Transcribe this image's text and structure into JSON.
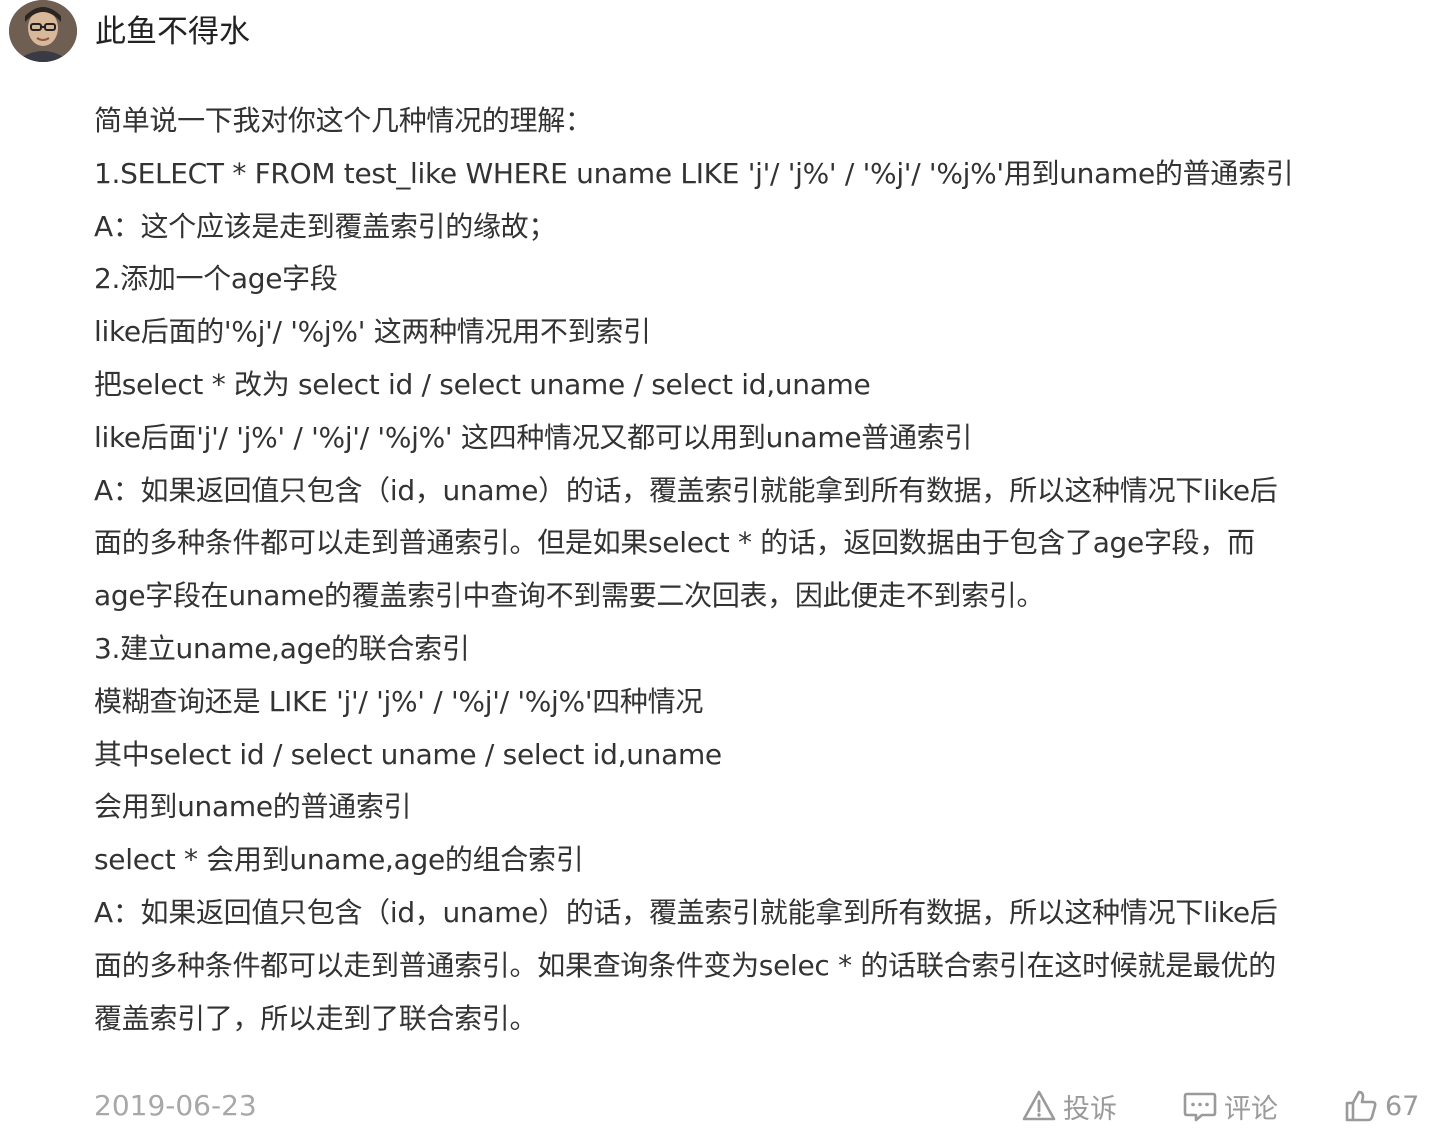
{
  "author": {
    "name": "此鱼不得水"
  },
  "comment": {
    "lines": [
      "简单说一下我对你这个几种情况的理解：",
      "1.SELECT * FROM test_like WHERE uname LIKE 'j'/ 'j%' / '%j'/ '%j%'用到uname的普通索引",
      "A：这个应该是走到覆盖索引的缘故；",
      "2.添加一个age字段",
      "like后面的'%j'/ '%j%' 这两种情况用不到索引",
      "把select * 改为 select id / select uname / select id,uname",
      "like后面'j'/ 'j%' / '%j'/ '%j%' 这四种情况又都可以用到uname普通索引",
      "A：如果返回值只包含（id，uname）的话，覆盖索引就能拿到所有数据，所以这种情况下like后",
      "面的多种条件都可以走到普通索引。但是如果select * 的话，返回数据由于包含了age字段，而",
      "age字段在uname的覆盖索引中查询不到需要二次回表，因此便走不到索引。",
      "3.建立uname,age的联合索引",
      "模糊查询还是 LIKE 'j'/ 'j%' / '%j'/ '%j%'四种情况",
      "其中select id / select uname / select id,uname",
      "会用到uname的普通索引",
      "select * 会用到uname,age的组合索引",
      "A：如果返回值只包含（id，uname）的话，覆盖索引就能拿到所有数据，所以这种情况下like后",
      "面的多种条件都可以走到普通索引。如果查询条件变为selec * 的话联合索引在这时候就是最优的",
      "覆盖索引了，所以走到了联合索引。"
    ]
  },
  "footer": {
    "date": "2019-06-23",
    "report_label": "投诉",
    "reply_label": "评论",
    "like_count": "67",
    "icons": {
      "report": "warning-triangle-icon",
      "reply": "comment-bubble-icon",
      "like": "thumbs-up-icon"
    }
  }
}
